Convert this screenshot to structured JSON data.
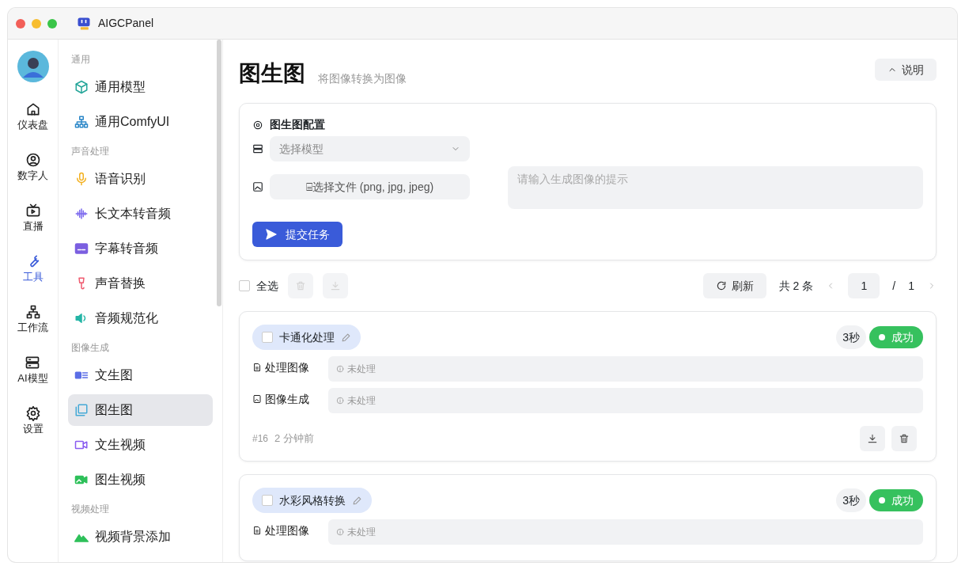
{
  "window": {
    "title": "AIGCPanel"
  },
  "rail": [
    {
      "label": "仪表盘",
      "selected": false
    },
    {
      "label": "数字人",
      "selected": false
    },
    {
      "label": "直播",
      "selected": false
    },
    {
      "label": "工具",
      "selected": true
    },
    {
      "label": "工作流",
      "selected": false
    },
    {
      "label": "AI模型",
      "selected": false
    },
    {
      "label": "设置",
      "selected": false
    }
  ],
  "menu": [
    {
      "title": "通用",
      "items": [
        {
          "label": "通用模型",
          "selected": false
        },
        {
          "label": "通用ComfyUI",
          "selected": false
        }
      ]
    },
    {
      "title": "声音处理",
      "items": [
        {
          "label": "语音识别",
          "selected": false
        },
        {
          "label": "长文本转音频",
          "selected": false
        },
        {
          "label": "字幕转音频",
          "selected": false
        },
        {
          "label": "声音替换",
          "selected": false
        },
        {
          "label": "音频规范化",
          "selected": false
        }
      ]
    },
    {
      "title": "图像生成",
      "items": [
        {
          "label": "文生图",
          "selected": false
        },
        {
          "label": "图生图",
          "selected": true
        },
        {
          "label": "文生视频",
          "selected": false
        },
        {
          "label": "图生视频",
          "selected": false
        }
      ]
    },
    {
      "title": "视频处理",
      "items": [
        {
          "label": "视频背景添加",
          "selected": false
        }
      ]
    }
  ],
  "page": {
    "title": "图生图",
    "subtitle": "将图像转换为图像",
    "help_button": "说明"
  },
  "config": {
    "title": "图生图配置",
    "model_select": {
      "placeholder": "选择模型"
    },
    "file_button": "⌸选择文件 (png, jpg, jpeg)",
    "prompt": {
      "placeholder": "请输入生成图像的提示"
    },
    "submit": "提交任务"
  },
  "toolbar": {
    "select_all": {
      "label": "全选",
      "checked": false
    },
    "refresh": "刷新",
    "total": "共 2 条",
    "page_current": "1",
    "page_separator": "/",
    "page_total": "1"
  },
  "tasks": [
    {
      "title": "卡通化处理",
      "checked": false,
      "duration": "3秒",
      "status": {
        "label": "成功",
        "kind": "success"
      },
      "fields": [
        {
          "label": "处理图像",
          "value": "未处理"
        },
        {
          "label": "图像生成",
          "value": "未处理"
        }
      ],
      "id": "#16",
      "time": "2 分钟前"
    },
    {
      "title": "水彩风格转换",
      "checked": false,
      "duration": "3秒",
      "status": {
        "label": "成功",
        "kind": "success"
      },
      "fields": [
        {
          "label": "处理图像",
          "value": "未处理"
        }
      ]
    }
  ]
}
